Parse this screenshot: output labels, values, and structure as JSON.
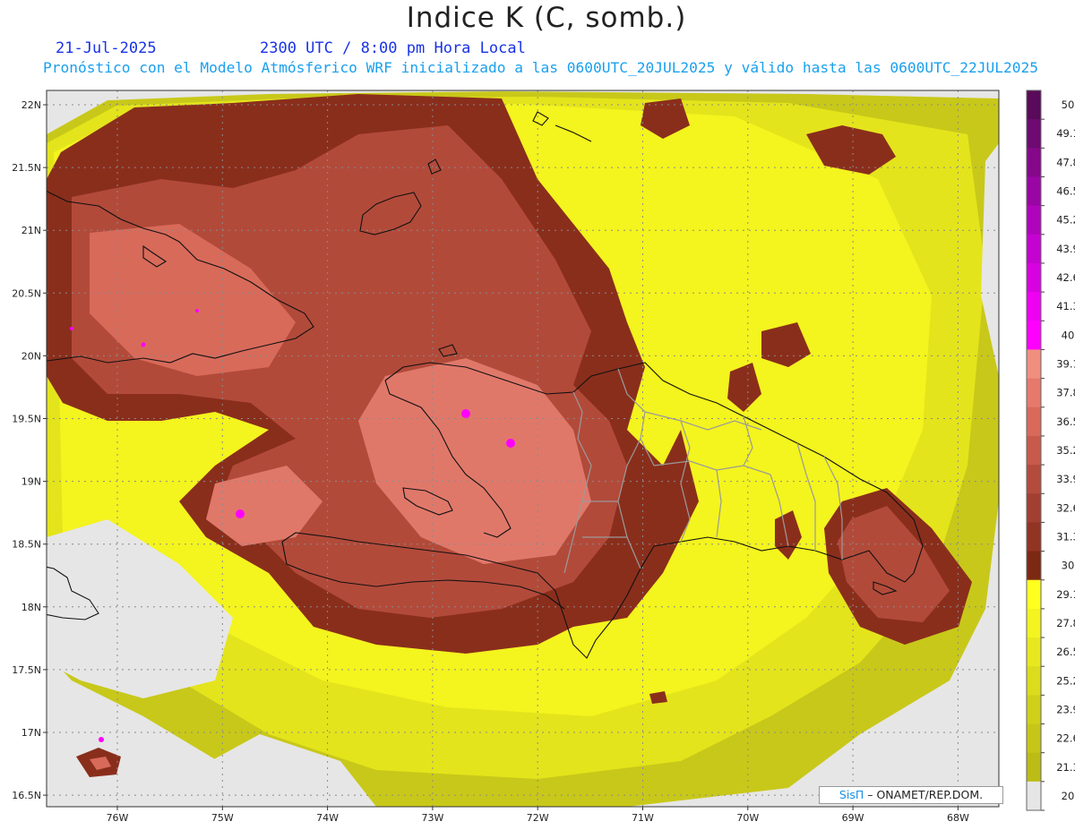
{
  "header": {
    "title": "Indice K (C, somb.)",
    "date": "21-Jul-2025",
    "valid_time": "2300 UTC / 8:00 pm Hora Local",
    "forecast_info": "Pronóstico con el Modelo Atmósferico WRF inicializado a las 0600UTC_20JUL2025 y válido hasta las  0600UTC_22JUL2025"
  },
  "map": {
    "lat_labels": [
      "22N",
      "21.5N",
      "21N",
      "20.5N",
      "20N",
      "19.5N",
      "19N",
      "18.5N",
      "18N",
      "17.5N",
      "17N",
      "16.5N"
    ],
    "lon_labels": [
      "76W",
      "75W",
      "74W",
      "73W",
      "72W",
      "71W",
      "70W",
      "69W",
      "68W"
    ]
  },
  "colorbar": {
    "levels": [
      "50",
      "49.1",
      "47.8",
      "46.5",
      "45.2",
      "43.9",
      "42.6",
      "41.3",
      "40",
      "39.1",
      "37.8",
      "36.5",
      "35.2",
      "33.9",
      "32.6",
      "31.3",
      "30",
      "29.1",
      "27.8",
      "26.5",
      "25.2",
      "23.9",
      "22.6",
      "21.3",
      "20"
    ],
    "colors": [
      "#5a0a5a",
      "#6e0a72",
      "#85088a",
      "#9a06a4",
      "#b004bc",
      "#c403d0",
      "#d802e0",
      "#ee00f2",
      "#ff00ff",
      "#f08f80",
      "#e57a6c",
      "#d8695b",
      "#c85a4c",
      "#b44c3e",
      "#a23f32",
      "#923424",
      "#7d2812",
      "#ffff20",
      "#f4f420",
      "#e8e820",
      "#dcdc1c",
      "#d0d01a",
      "#c6c618",
      "#bcbc16",
      "#e6e6e6"
    ]
  },
  "credit": {
    "brand": "SisΠ",
    "text": "– ONAMET/REP.DOM."
  }
}
